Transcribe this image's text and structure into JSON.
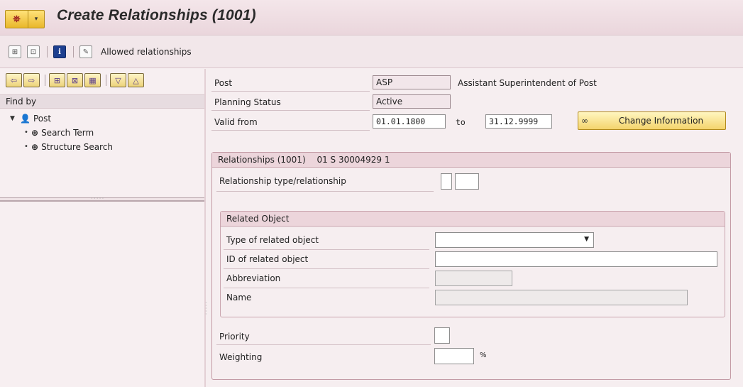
{
  "window": {
    "title": "Create Relationships (1001)"
  },
  "toolbar": {
    "allowed_relationships_label": "Allowed relationships"
  },
  "navigation": {
    "find_by_label": "Find by",
    "tree": {
      "root_label": "Post",
      "children": [
        {
          "label": "Search Term"
        },
        {
          "label": "Structure Search"
        }
      ]
    }
  },
  "header": {
    "post_label": "Post",
    "post_code": "ASP",
    "post_name": "Assistant Superintendent of Post",
    "planning_status_label": "Planning Status",
    "planning_status_value": "Active",
    "valid_from_label": "Valid from",
    "valid_from_value": "01.01.1800",
    "to_label": "to",
    "valid_to_value": "31.12.9999",
    "change_info_label": "Change Information"
  },
  "relationships": {
    "title": "Relationships (1001)",
    "key": "01 S  30004929 1",
    "type_label": "Relationship type/relationship",
    "type_value": "",
    "relationship_value": "",
    "related_object": {
      "title": "Related Object",
      "type_label": "Type of related object",
      "type_value": "",
      "id_label": "ID of related object",
      "id_value": "",
      "abbreviation_label": "Abbreviation",
      "abbreviation_value": "",
      "name_label": "Name",
      "name_value": ""
    },
    "priority_label": "Priority",
    "priority_value": "",
    "weighting_label": "Weighting",
    "weighting_value": "",
    "weighting_unit": "%"
  }
}
